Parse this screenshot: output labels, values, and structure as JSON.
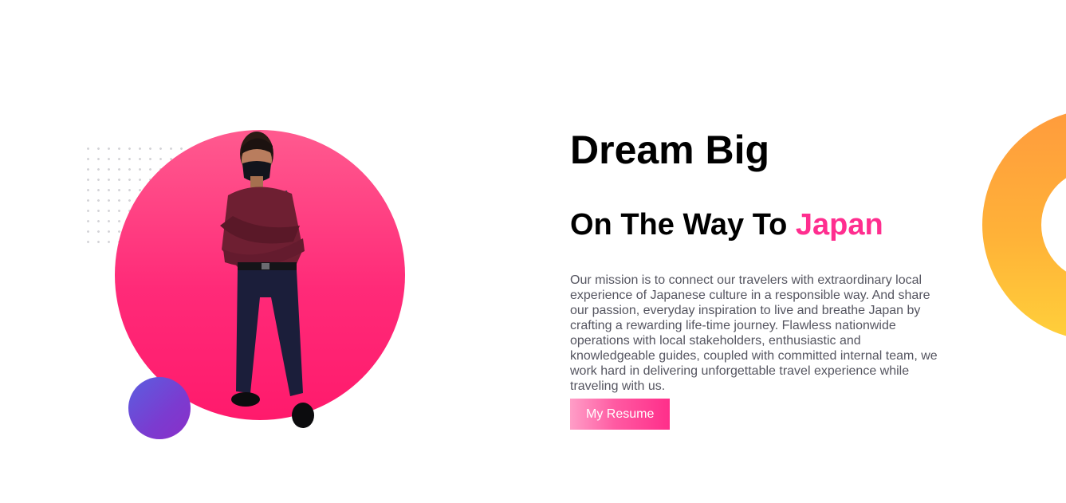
{
  "hero": {
    "headline": "Dream Big",
    "subline_prefix": "On The Way To ",
    "subline_accent": "Japan",
    "mission": "Our mission is to connect our travelers with extraordinary local experience of Japanese culture in a responsible way. And share our passion, everyday inspiration to live and breathe Japan by crafting a rewarding life-time journey. Flawless nationwide operations with local stakeholders, enthusiastic and knowledgeable guides, coupled with committed internal team, we work hard in delivering unforgettable travel experience while traveling with us.",
    "resume_button": "My Resume"
  },
  "colors": {
    "accent": "#ff2e8f",
    "hero_circle": "#ff2a78",
    "small_circle": "#6a4ad8",
    "ring": "#ffb238",
    "body_text": "#555560"
  },
  "images": {
    "portrait": "person-portrait"
  }
}
